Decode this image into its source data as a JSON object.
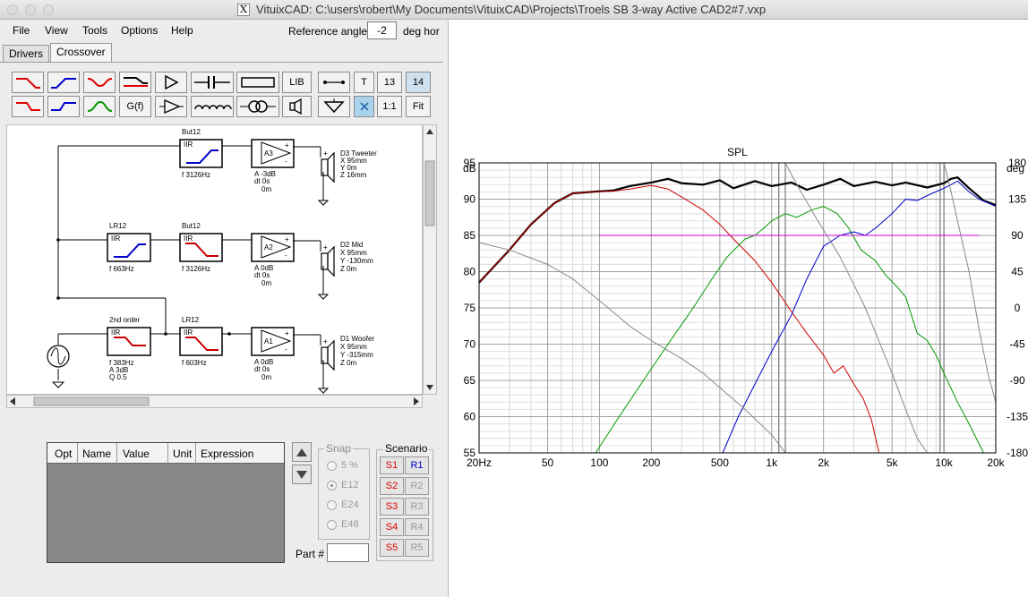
{
  "window": {
    "title": "VituixCAD: C:\\users\\robert\\My Documents\\VituixCAD\\Projects\\Troels SB 3-way Active CAD2#7.vxp",
    "icon_glyph": "X"
  },
  "menu": [
    {
      "label": "File"
    },
    {
      "label": "View"
    },
    {
      "label": "Tools"
    },
    {
      "label": "Options"
    },
    {
      "label": "Help"
    }
  ],
  "reference": {
    "label": "Reference angle",
    "value": "-2",
    "unit": "deg hor"
  },
  "tabs": [
    {
      "label": "Drivers",
      "active": false
    },
    {
      "label": "Crossover",
      "active": true
    }
  ],
  "toolbar": {
    "lib": "LIB",
    "t": "T",
    "n13": "13",
    "n14": "14",
    "gf": "G(f)",
    "one_to_one": "1:1",
    "fit": "Fit"
  },
  "schematic": {
    "blocks": [
      {
        "top": "But12",
        "name": "IIR",
        "params": [
          "f  3126Hz"
        ]
      },
      {
        "top": "LR12",
        "name": "IIR",
        "params": [
          "f  663Hz"
        ]
      },
      {
        "top": "But12",
        "name": "IIR",
        "params": [
          "f  3126Hz"
        ]
      },
      {
        "top": "2nd order",
        "name": "IIR",
        "params": [
          "f  383Hz",
          "A  3dB",
          "Q  0.5"
        ]
      },
      {
        "top": "LR12",
        "name": "IIR",
        "params": [
          "f  603Hz"
        ]
      }
    ],
    "amps": [
      {
        "name": "A3",
        "params": [
          "A -3dB",
          "dt 0s",
          "0m"
        ]
      },
      {
        "name": "A2",
        "params": [
          "A 0dB",
          "dt 0s",
          "0m"
        ]
      },
      {
        "name": "A1",
        "params": [
          "A 0dB",
          "dt 0s",
          "0m"
        ]
      }
    ],
    "drivers": [
      {
        "params": [
          "D3 Tweeter",
          "X 95mm",
          "Y 0m",
          "Z 16mm"
        ]
      },
      {
        "params": [
          "D2 Mid",
          "X 95mm",
          "Y -130mm",
          "Z 0m"
        ]
      },
      {
        "params": [
          "D1 Woofer",
          "X 95mm",
          "Y -315mm",
          "Z 0m"
        ]
      }
    ],
    "plus": "+",
    "minus": "-"
  },
  "opt_table": {
    "columns": [
      "Opt",
      "Name",
      "Value",
      "Unit",
      "Expression"
    ]
  },
  "snap": {
    "title": "Snap",
    "options": [
      {
        "label": "5 %",
        "selected": false
      },
      {
        "label": "E12",
        "selected": true
      },
      {
        "label": "E24",
        "selected": false
      },
      {
        "label": "E48",
        "selected": false
      }
    ]
  },
  "scenario": {
    "title": "Scenario",
    "s": [
      "S1",
      "S2",
      "S3",
      "S4",
      "S5"
    ],
    "r": [
      "R1",
      "R2",
      "R3",
      "R4",
      "R5"
    ]
  },
  "part": {
    "label": "Part #",
    "value": ""
  },
  "colors": {
    "red": "#dd0000",
    "blue": "#0000cc",
    "green": "#009900",
    "magenta": "#cc00cc",
    "gray": "#8a8a8a"
  },
  "chart_data": {
    "type": "line",
    "title": "SPL",
    "x_scale": "log",
    "xlim": [
      20,
      20000
    ],
    "x_ticks": [
      "20Hz",
      "50",
      "100",
      "200",
      "500",
      "1k",
      "2k",
      "5k",
      "10k",
      "20k"
    ],
    "ylim": [
      55,
      95
    ],
    "y_unit": "dB",
    "y_ticks": [
      "95",
      "90",
      "85",
      "80",
      "75",
      "70",
      "65",
      "60",
      "55"
    ],
    "y2_unit": "deg",
    "y2lim": [
      -180,
      180
    ],
    "y2_ticks": [
      "180",
      "135",
      "90",
      "45",
      "0",
      "-45",
      "-90",
      "-135",
      "-180"
    ],
    "series": [
      {
        "color": "#000000",
        "width": 2.2,
        "points": [
          [
            20,
            78.5
          ],
          [
            30,
            83
          ],
          [
            40,
            86.5
          ],
          [
            55,
            89.5
          ],
          [
            70,
            90.8
          ],
          [
            90,
            91
          ],
          [
            120,
            91.2
          ],
          [
            150,
            91.8
          ],
          [
            200,
            92.3
          ],
          [
            250,
            92.8
          ],
          [
            300,
            92.2
          ],
          [
            400,
            92
          ],
          [
            500,
            92.6
          ],
          [
            600,
            91.5
          ],
          [
            800,
            92.5
          ],
          [
            1000,
            91.8
          ],
          [
            1300,
            92.3
          ],
          [
            1600,
            91.3
          ],
          [
            2000,
            92
          ],
          [
            2500,
            92.8
          ],
          [
            3000,
            91.8
          ],
          [
            4000,
            92.4
          ],
          [
            5000,
            91.9
          ],
          [
            6000,
            92.3
          ],
          [
            8000,
            91.6
          ],
          [
            10000,
            92.2
          ],
          [
            11000,
            92.8
          ],
          [
            12000,
            93
          ],
          [
            14000,
            91.5
          ],
          [
            17000,
            89.8
          ],
          [
            20000,
            89.2
          ]
        ]
      },
      {
        "color": "#cc0000",
        "width": 1,
        "points": [
          [
            20,
            78.5
          ],
          [
            30,
            83
          ],
          [
            40,
            86.5
          ],
          [
            55,
            89.5
          ],
          [
            70,
            90.8
          ],
          [
            90,
            91
          ],
          [
            120,
            91.1
          ],
          [
            150,
            91.4
          ],
          [
            200,
            91.9
          ],
          [
            250,
            91.4
          ],
          [
            300,
            90.3
          ],
          [
            400,
            88.5
          ],
          [
            500,
            86.5
          ],
          [
            600,
            84.5
          ],
          [
            800,
            81.5
          ],
          [
            1000,
            78.5
          ],
          [
            1300,
            74.5
          ],
          [
            1600,
            71.5
          ],
          [
            2000,
            68.5
          ],
          [
            2300,
            66
          ],
          [
            2600,
            67
          ],
          [
            3000,
            64.5
          ],
          [
            3400,
            62.5
          ],
          [
            3800,
            59.5
          ],
          [
            4200,
            55
          ]
        ]
      },
      {
        "color": "#009900",
        "width": 1,
        "points": [
          [
            95,
            55
          ],
          [
            130,
            60
          ],
          [
            180,
            65
          ],
          [
            250,
            70
          ],
          [
            350,
            75
          ],
          [
            450,
            79
          ],
          [
            550,
            82
          ],
          [
            700,
            84.5
          ],
          [
            800,
            85
          ],
          [
            900,
            86
          ],
          [
            1000,
            87
          ],
          [
            1200,
            88
          ],
          [
            1400,
            87.5
          ],
          [
            1700,
            88.5
          ],
          [
            2000,
            89
          ],
          [
            2400,
            88
          ],
          [
            2800,
            86
          ],
          [
            3300,
            83
          ],
          [
            4000,
            81.5
          ],
          [
            4600,
            79.5
          ],
          [
            5300,
            78
          ],
          [
            6000,
            76.5
          ],
          [
            7000,
            71.5
          ],
          [
            8000,
            70.5
          ],
          [
            9000,
            68.5
          ],
          [
            10000,
            66
          ],
          [
            12000,
            62
          ],
          [
            14000,
            59
          ],
          [
            17000,
            55
          ]
        ]
      },
      {
        "color": "#0000cc",
        "width": 1,
        "points": [
          [
            520,
            55
          ],
          [
            640,
            60
          ],
          [
            820,
            65
          ],
          [
            1000,
            69
          ],
          [
            1300,
            74
          ],
          [
            1600,
            79
          ],
          [
            2000,
            83.5
          ],
          [
            2500,
            85
          ],
          [
            3000,
            85.5
          ],
          [
            3500,
            85
          ],
          [
            4000,
            86
          ],
          [
            5000,
            88
          ],
          [
            6000,
            90
          ],
          [
            7000,
            89.8
          ],
          [
            8000,
            90.5
          ],
          [
            10000,
            91.5
          ],
          [
            11000,
            92
          ],
          [
            12000,
            92.5
          ],
          [
            14000,
            91
          ],
          [
            16000,
            90
          ],
          [
            20000,
            89
          ]
        ]
      },
      {
        "color": "#cc00cc",
        "width": 1,
        "points": [
          [
            100,
            85
          ],
          [
            16000,
            85
          ]
        ]
      },
      {
        "color": "#888888",
        "width": 1,
        "points": [
          [
            20,
            84
          ],
          [
            30,
            83
          ],
          [
            50,
            81
          ],
          [
            70,
            79
          ],
          [
            100,
            76
          ],
          [
            150,
            72.5
          ],
          [
            200,
            70.5
          ],
          [
            300,
            68
          ],
          [
            400,
            66
          ],
          [
            500,
            64
          ],
          [
            700,
            61
          ],
          [
            1000,
            57.5
          ],
          [
            1200,
            55
          ]
        ]
      },
      {
        "color": "#888888",
        "width": 1,
        "points": [
          [
            1200,
            95
          ],
          [
            1400,
            92
          ],
          [
            1800,
            87.5
          ],
          [
            2500,
            82
          ],
          [
            3500,
            75
          ],
          [
            5000,
            66
          ],
          [
            6000,
            61
          ],
          [
            7000,
            57
          ],
          [
            8000,
            55
          ]
        ]
      },
      {
        "color": "#888888",
        "width": 1,
        "points": [
          [
            10000,
            95
          ],
          [
            11000,
            91
          ],
          [
            12000,
            87
          ],
          [
            14000,
            80
          ],
          [
            16000,
            72
          ],
          [
            18000,
            66
          ],
          [
            20000,
            62
          ]
        ]
      }
    ],
    "vlines": [
      1100,
      1200,
      9500,
      10000
    ]
  }
}
